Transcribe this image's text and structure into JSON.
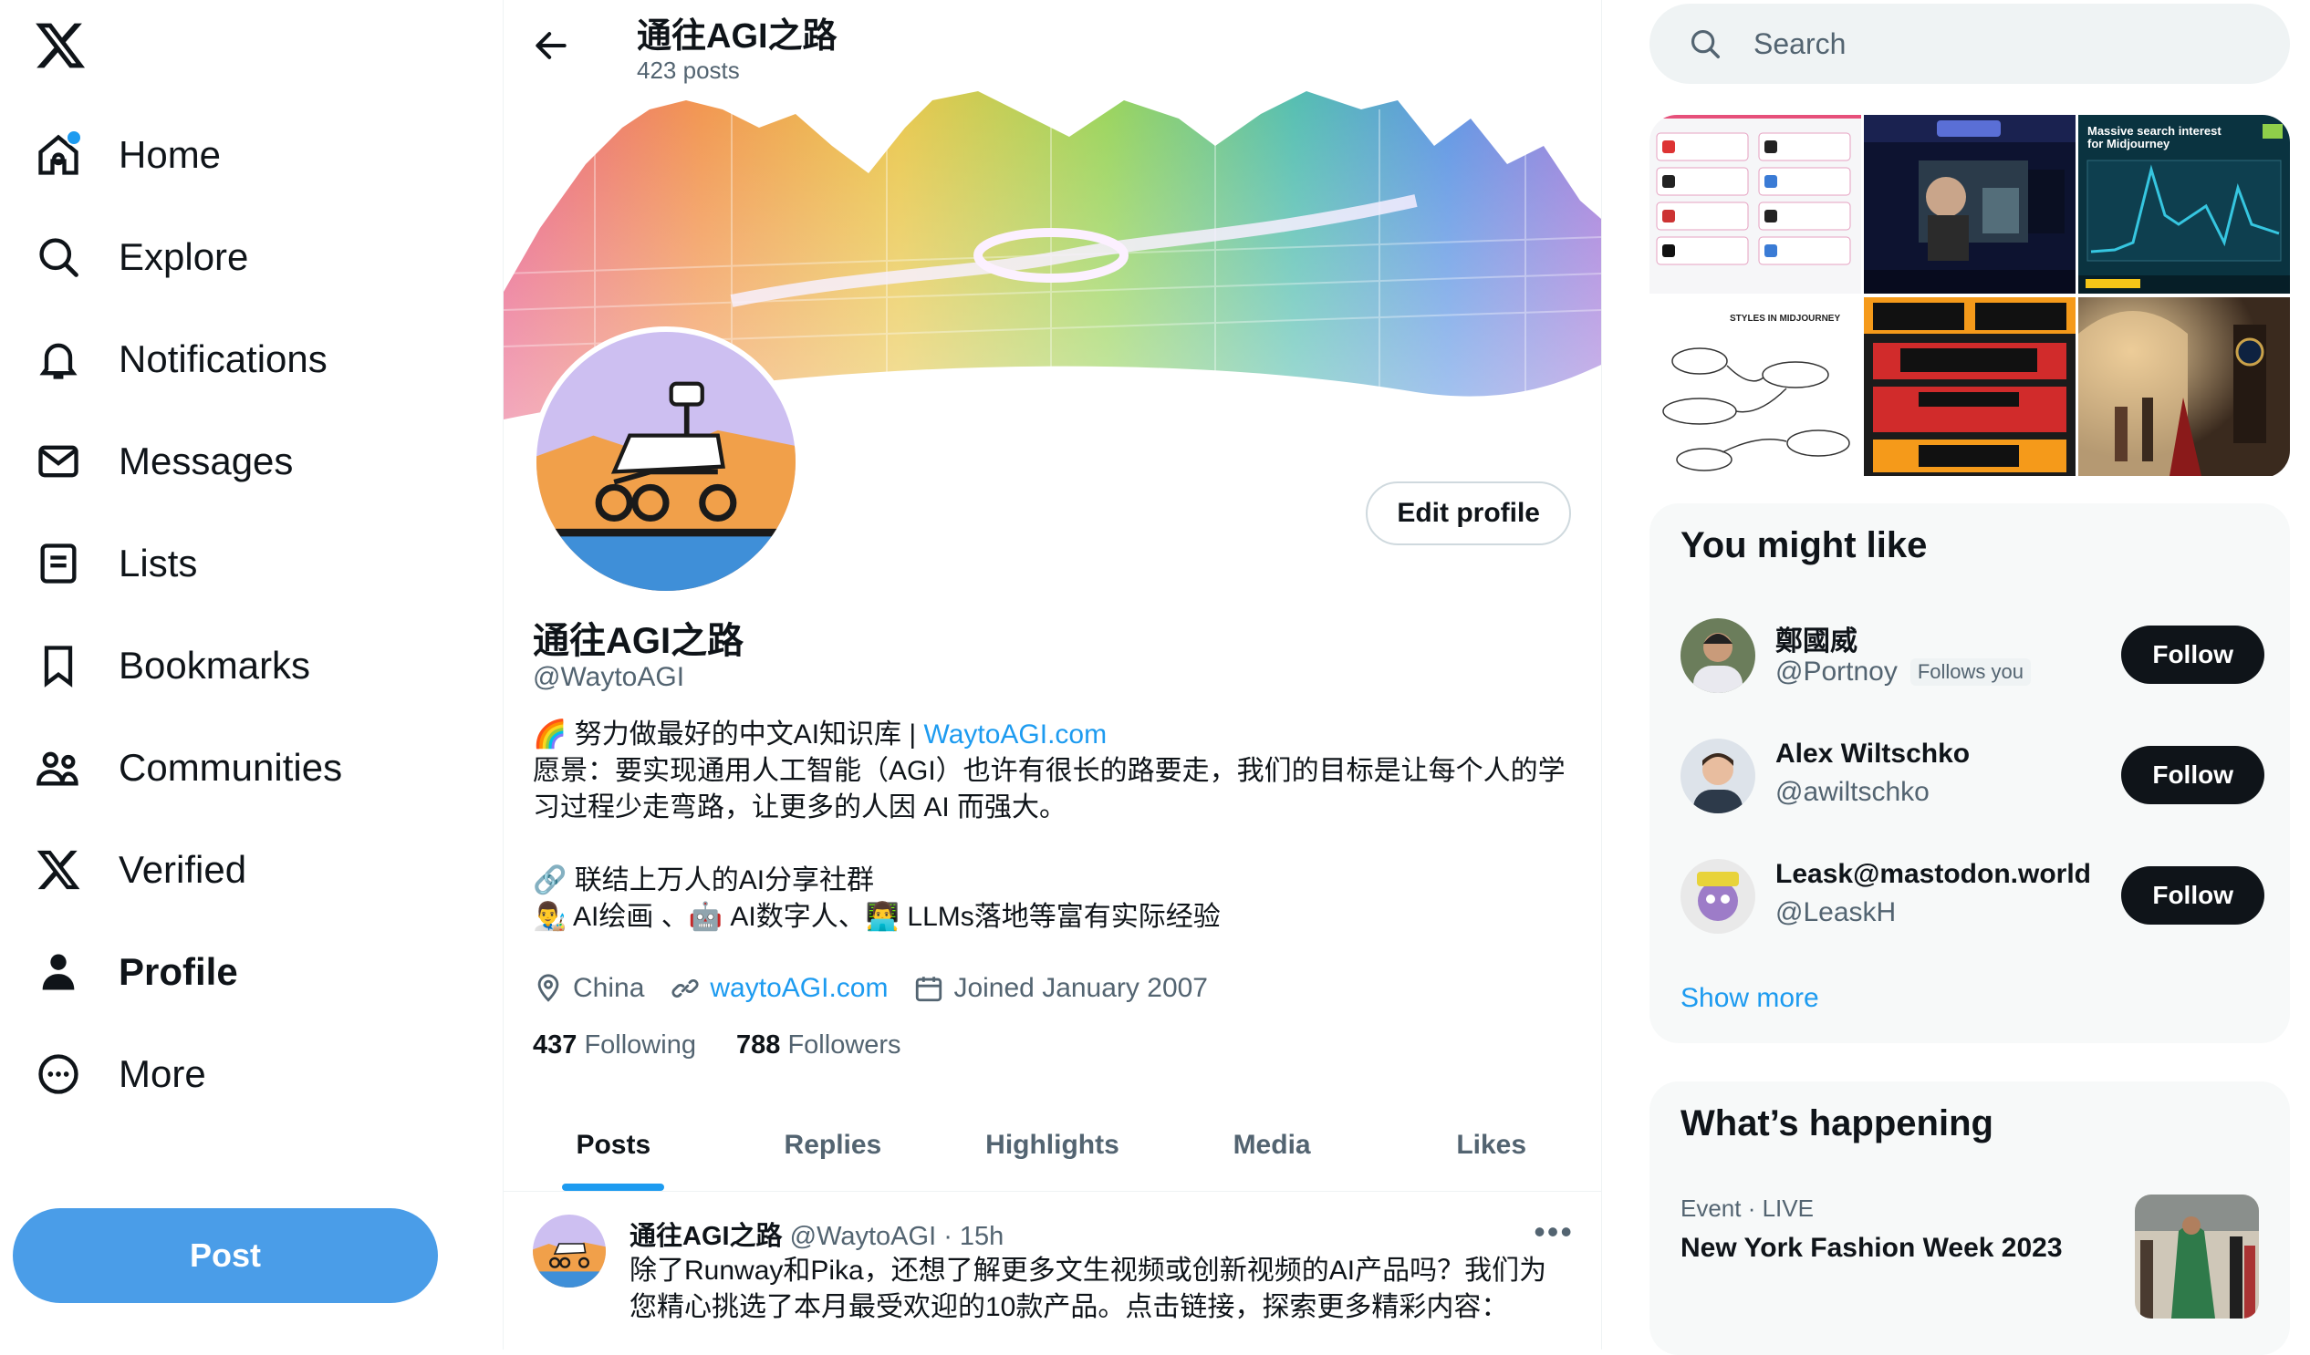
{
  "colors": {
    "accent": "#1d9bf0",
    "post_button": "#4a9de8",
    "text": "#0f1419",
    "muted": "#536471"
  },
  "sidebar": {
    "logo_icon": "x-logo-icon",
    "items": [
      {
        "label": "Home",
        "icon": "home-icon"
      },
      {
        "label": "Explore",
        "icon": "search-icon"
      },
      {
        "label": "Notifications",
        "icon": "bell-icon"
      },
      {
        "label": "Messages",
        "icon": "envelope-icon"
      },
      {
        "label": "Lists",
        "icon": "list-icon"
      },
      {
        "label": "Bookmarks",
        "icon": "bookmark-icon"
      },
      {
        "label": "Communities",
        "icon": "people-icon"
      },
      {
        "label": "Verified",
        "icon": "x-logo-icon"
      },
      {
        "label": "Profile",
        "icon": "person-icon",
        "active": true
      },
      {
        "label": "More",
        "icon": "more-circle-icon"
      }
    ],
    "post_label": "Post"
  },
  "header": {
    "title": "通往AGI之路",
    "post_count": "423 posts"
  },
  "profile": {
    "name": "通往AGI之路",
    "handle": "@WaytoAGI",
    "edit_label": "Edit profile",
    "bio_line1_prefix": "🌈 努力做最好的中文AI知识库 | ",
    "bio_line1_link": "WaytoAGI.com",
    "bio_line2": "愿景：要实现通用人工智能（AGI）也许有很长的路要走，我们的目标是让每个人的学",
    "bio_line3": "习过程少走弯路，让更多的人因 AI 而强大。",
    "bio_line4": "🔗 联结上万人的AI分享社群",
    "bio_line5": "👨‍🎨 AI绘画 、🤖 AI数字人、👨‍💻 LLMs落地等富有实际经验",
    "location": "China",
    "website": "waytoAGI.com",
    "joined": "Joined January 2007",
    "following_count": "437",
    "following_label": "Following",
    "followers_count": "788",
    "followers_label": "Followers"
  },
  "tabs": [
    "Posts",
    "Replies",
    "Highlights",
    "Media",
    "Likes"
  ],
  "tweet": {
    "name": "通往AGI之路",
    "handle_time": "@WaytoAGI · 15h",
    "line1": "除了Runway和Pika，还想了解更多文生视频或创新视频的AI产品吗？我们为",
    "line2": "您精心挑选了本月最受欢迎的10款产品。点击链接，探索更多精彩内容："
  },
  "search": {
    "placeholder": "Search"
  },
  "media_thumbs": {
    "t1_label": "STYLES IN MIDJOURNEY",
    "t3_label1": "Massive search interest",
    "t3_label2": "for Midjourney"
  },
  "you_might_like": {
    "title": "You might like",
    "follow_label": "Follow",
    "users": [
      {
        "name": "鄭國威",
        "handle": "@Portnoy",
        "badge": "Follows you"
      },
      {
        "name": "Alex Wiltschko",
        "handle": "@awiltschko"
      },
      {
        "name": "Leask@mastodon.world",
        "handle": "@LeaskH"
      }
    ],
    "show_more": "Show more"
  },
  "whats_happening": {
    "title": "What’s happening",
    "trend_meta": "Event · LIVE",
    "trend_name": "New York Fashion Week 2023"
  }
}
